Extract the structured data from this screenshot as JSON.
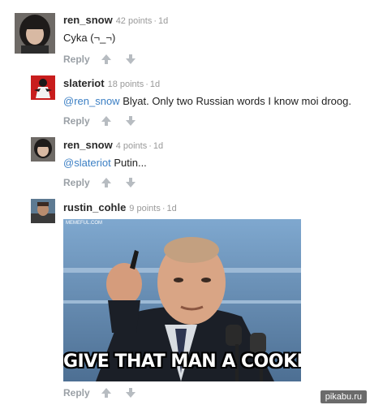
{
  "comments": [
    {
      "author": "ren_snow",
      "points": "42 points",
      "separator": "·",
      "age": "1d",
      "mention": "",
      "text": "Cyka (¬_¬)",
      "reply_label": "Reply"
    },
    {
      "author": "slateriot",
      "points": "18 points",
      "separator": "·",
      "age": "1d",
      "mention": "@ren_snow",
      "text": " Blyat. Only two Russian words I know moi droog.",
      "reply_label": "Reply"
    },
    {
      "author": "ren_snow",
      "points": "4 points",
      "separator": "·",
      "age": "1d",
      "mention": "@slateriot",
      "text": " Putin...",
      "reply_label": "Reply"
    },
    {
      "author": "rustin_cohle",
      "points": "9 points",
      "separator": "·",
      "age": "1d",
      "image_caption": "GIVE THAT MAN A COOKIE",
      "image_source": "MEMEFUL.COM",
      "reply_label": "Reply"
    }
  ],
  "icons": {
    "upvote": "arrow-up-icon",
    "downvote": "arrow-down-icon"
  },
  "colors": {
    "mention": "#3b7fc4",
    "muted": "#999999",
    "reply": "#9aa0a6"
  },
  "watermark": "pikabu.ru"
}
